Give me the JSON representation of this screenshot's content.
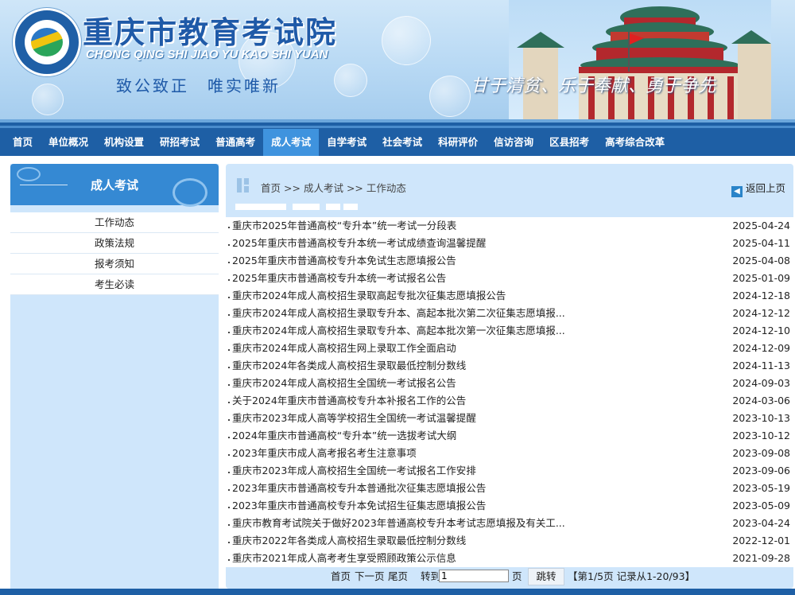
{
  "header": {
    "title": "重庆市教育考试院",
    "pinyin": "CHONG QING SHI JIAO YU KAO SHI YUAN",
    "motto_left": "致公致正　唯实唯新",
    "motto_right": "甘于清贫、乐于奉献、勇于争先"
  },
  "nav": {
    "items": [
      "首页",
      "单位概况",
      "机构设置",
      "研招考试",
      "普通高考",
      "成人考试",
      "自学考试",
      "社会考试",
      "科研评价",
      "信访咨询",
      "区县招考",
      "高考综合改革"
    ],
    "active": "成人考试"
  },
  "sidebar": {
    "title": "成人考试",
    "links": [
      "工作动态",
      "政策法规",
      "报考须知",
      "考生必读"
    ]
  },
  "breadcrumb": {
    "home": "首页",
    "sep1": ">>",
    "section": "成人考试",
    "sep2": ">>",
    "current": "工作动态"
  },
  "back_label": "返回上页",
  "articles": [
    {
      "title": "重庆市2025年普通高校“专升本”统一考试一分段表",
      "date": "2025-04-24"
    },
    {
      "title": "2025年重庆市普通高校专升本统一考试成绩查询温馨提醒",
      "date": "2025-04-11"
    },
    {
      "title": "2025年重庆市普通高校专升本免试生志愿填报公告",
      "date": "2025-04-08"
    },
    {
      "title": "2025年重庆市普通高校专升本统一考试报名公告",
      "date": "2025-01-09"
    },
    {
      "title": "重庆市2024年成人高校招生录取高起专批次征集志愿填报公告",
      "date": "2024-12-18"
    },
    {
      "title": "重庆市2024年成人高校招生录取专升本、高起本批次第二次征集志愿填报...",
      "date": "2024-12-12"
    },
    {
      "title": "重庆市2024年成人高校招生录取专升本、高起本批次第一次征集志愿填报...",
      "date": "2024-12-10"
    },
    {
      "title": "重庆市2024年成人高校招生网上录取工作全面启动",
      "date": "2024-12-09"
    },
    {
      "title": "重庆市2024年各类成人高校招生录取最低控制分数线",
      "date": "2024-11-13"
    },
    {
      "title": "重庆市2024年成人高校招生全国统一考试报名公告",
      "date": "2024-09-03"
    },
    {
      "title": "关于2024年重庆市普通高校专升本补报名工作的公告",
      "date": "2024-03-06"
    },
    {
      "title": "重庆市2023年成人高等学校招生全国统一考试温馨提醒",
      "date": "2023-10-13"
    },
    {
      "title": "2024年重庆市普通高校“专升本”统一选拔考试大纲",
      "date": "2023-10-12"
    },
    {
      "title": "2023年重庆市成人高考报名考生注意事项",
      "date": "2023-09-08"
    },
    {
      "title": "重庆市2023年成人高校招生全国统一考试报名工作安排",
      "date": "2023-09-06"
    },
    {
      "title": "2023年重庆市普通高校专升本普通批次征集志愿填报公告",
      "date": "2023-05-19"
    },
    {
      "title": "2023年重庆市普通高校专升本免试招生征集志愿填报公告",
      "date": "2023-05-09"
    },
    {
      "title": "重庆市教育考试院关于做好2023年普通高校专升本考试志愿填报及有关工...",
      "date": "2023-04-24"
    },
    {
      "title": "重庆市2022年各类成人高校招生录取最低控制分数线",
      "date": "2022-12-01"
    },
    {
      "title": "重庆市2021年成人高考考生享受照顾政策公示信息",
      "date": "2021-09-28"
    }
  ],
  "pager": {
    "first": "首页",
    "next": "下一页",
    "last": "尾页",
    "goto_label": "转到",
    "page_input": "1",
    "page_unit": "页",
    "jump_button": "跳转",
    "summary": "【第1/5页  记录从1-20/93】"
  }
}
